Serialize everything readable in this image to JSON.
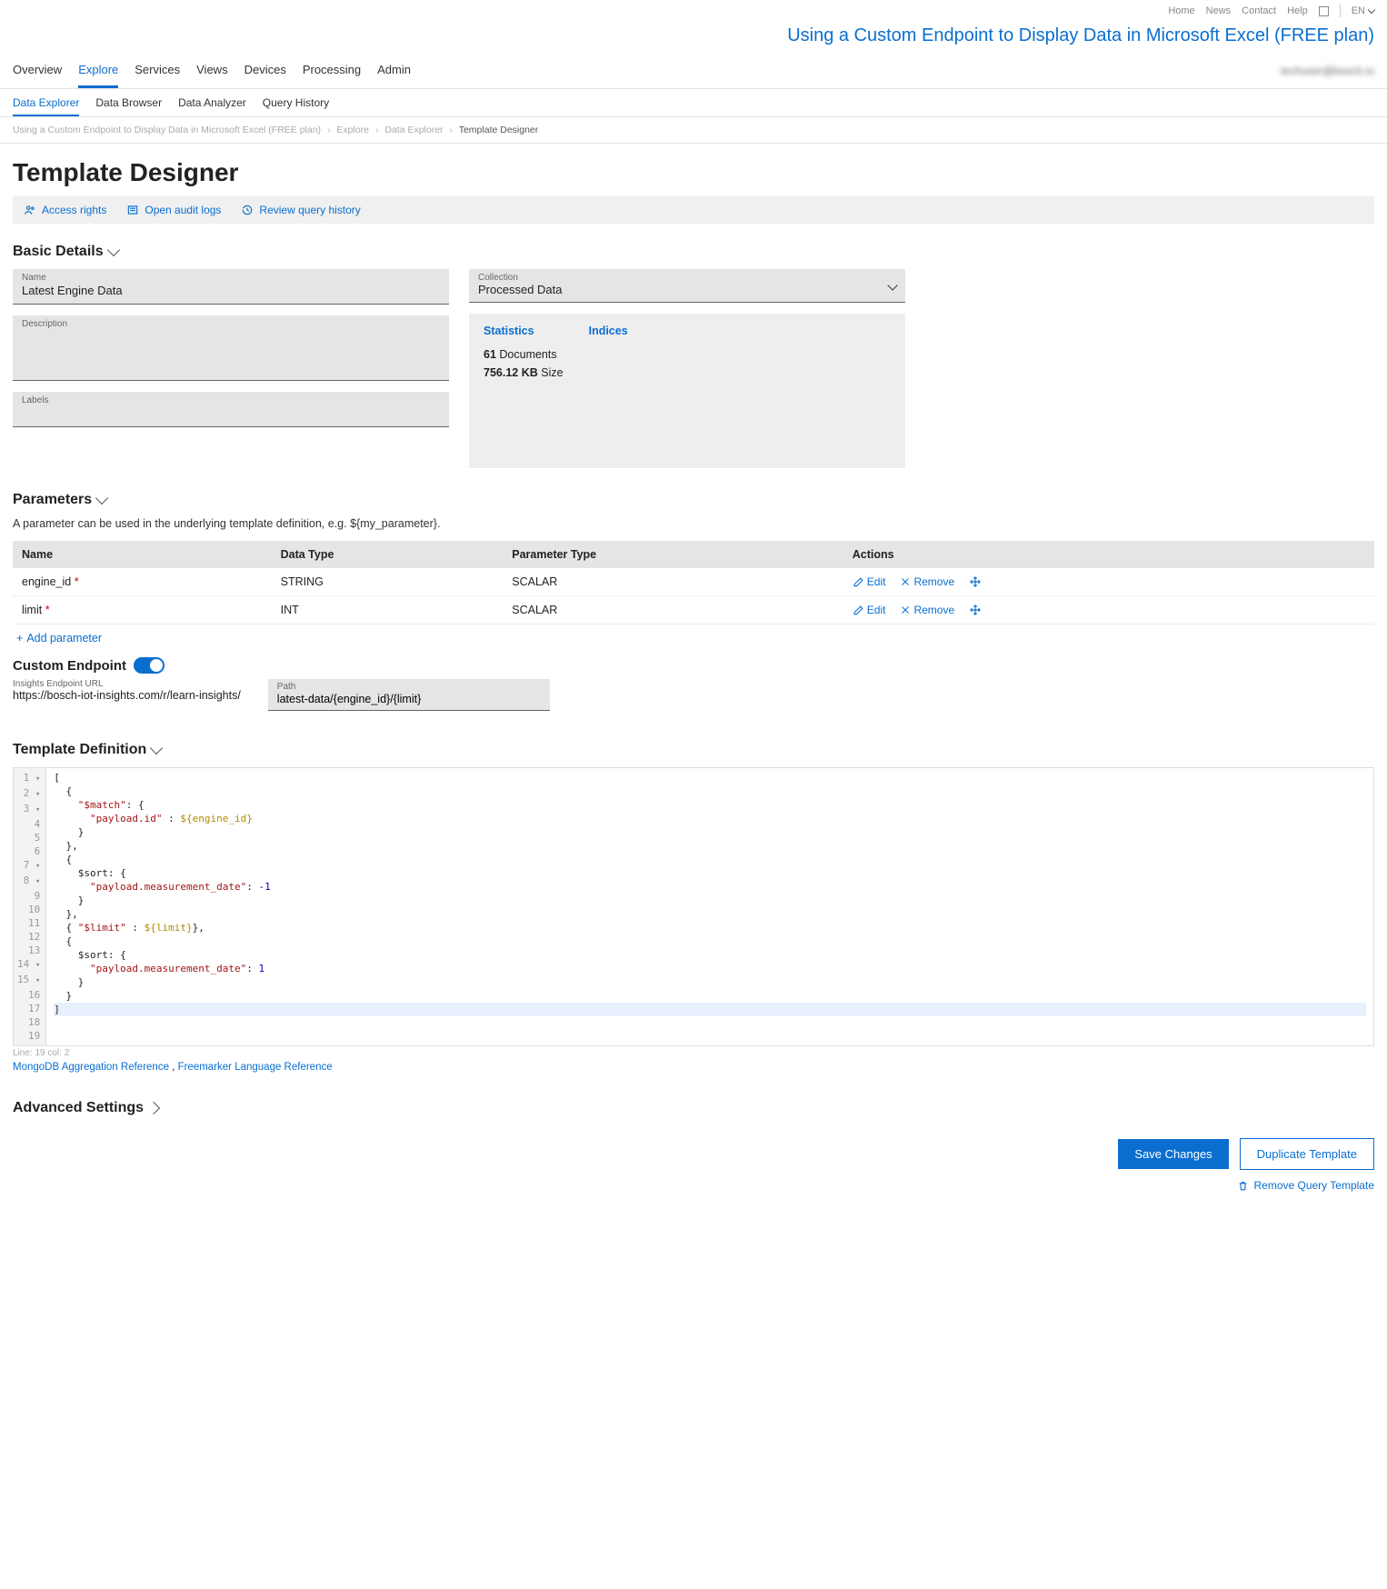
{
  "util": {
    "home": "Home",
    "news": "News",
    "contact": "Contact",
    "help": "Help",
    "lang": "EN"
  },
  "app_title": "Using a Custom Endpoint to Display Data in Microsoft Excel (FREE plan)",
  "nav": {
    "overview": "Overview",
    "explore": "Explore",
    "services": "Services",
    "views": "Views",
    "devices": "Devices",
    "processing": "Processing",
    "admin": "Admin",
    "user": "techuser@bosch.io"
  },
  "subnav": {
    "data_explorer": "Data Explorer",
    "data_browser": "Data Browser",
    "data_analyzer": "Data Analyzer",
    "query_history": "Query History"
  },
  "breadcrumb": {
    "p1": "Using a Custom Endpoint to Display Data in Microsoft Excel (FREE plan)",
    "p2": "Explore",
    "p3": "Data Explorer",
    "p4": "Template Designer"
  },
  "heading": "Template Designer",
  "actions": {
    "access": "Access rights",
    "audit": "Open audit logs",
    "history": "Review query history"
  },
  "sections": {
    "basic": "Basic Details",
    "params": "Parameters",
    "tmpl": "Template Definition",
    "adv": "Advanced Settings"
  },
  "basic": {
    "name_label": "Name",
    "name_value": "Latest Engine Data",
    "desc_label": "Description",
    "desc_value": "",
    "labels_label": "Labels",
    "labels_value": "",
    "collection_label": "Collection",
    "collection_value": "Processed Data"
  },
  "stats": {
    "tab_stats": "Statistics",
    "tab_indices": "Indices",
    "docs_value": "61",
    "docs_label": "Documents",
    "size_value": "756.12 KB",
    "size_label": "Size"
  },
  "params": {
    "hint": "A parameter can be used in the underlying template definition, e.g. ${my_parameter}.",
    "col_name": "Name",
    "col_type": "Data Type",
    "col_ptype": "Parameter Type",
    "col_actions": "Actions",
    "rows": [
      {
        "name": "engine_id",
        "type": "STRING",
        "ptype": "SCALAR"
      },
      {
        "name": "limit",
        "type": "INT",
        "ptype": "SCALAR"
      }
    ],
    "edit": "Edit",
    "remove": "Remove",
    "add": "Add parameter"
  },
  "ce": {
    "label": "Custom Endpoint",
    "url_label": "Insights Endpoint URL",
    "url_value": "https://bosch-iot-insights.com/r/learn-insights/",
    "path_label": "Path",
    "path_value": "latest-data/{engine_id}/{limit}"
  },
  "editor": {
    "cursor": "Line: 19 col: 2",
    "ref1": "MongoDB Aggregation Reference",
    "ref2": "Freemarker Language Reference"
  },
  "footer": {
    "save": "Save Changes",
    "dup": "Duplicate Template",
    "remove": "Remove Query Template"
  }
}
